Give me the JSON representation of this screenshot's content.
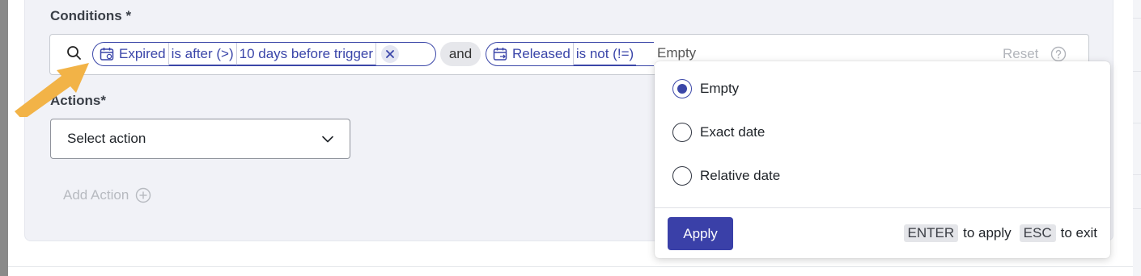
{
  "conditions": {
    "label": "Conditions *",
    "chips": [
      {
        "icon": "calendar-icon",
        "field": "Expired",
        "operator": "is after (>)",
        "value": "10 days before trigger",
        "remove_icon": "close-icon"
      },
      {
        "icon": "calendar-icon",
        "field": "Released",
        "operator": "is not (!=)"
      }
    ],
    "connector": "and",
    "pending_value": "Empty",
    "reset_label": "Reset",
    "help_icon": "help-icon",
    "search_icon": "search-icon"
  },
  "actions": {
    "label": "Actions*",
    "select_placeholder": "Select action",
    "chevron_icon": "chevron-down-icon",
    "add_label": "Add Action",
    "add_icon": "plus-circle-icon"
  },
  "dropdown": {
    "options": [
      {
        "label": "Empty",
        "selected": true
      },
      {
        "label": "Exact date",
        "selected": false
      },
      {
        "label": "Relative date",
        "selected": false
      }
    ],
    "apply_label": "Apply",
    "hints": [
      {
        "key": "ENTER",
        "text": "to apply"
      },
      {
        "key": "ESC",
        "text": "to exit"
      }
    ]
  },
  "colors": {
    "accent": "#3a40a8",
    "chip_border": "#3b47a8",
    "annotation_arrow": "#f2b347"
  }
}
